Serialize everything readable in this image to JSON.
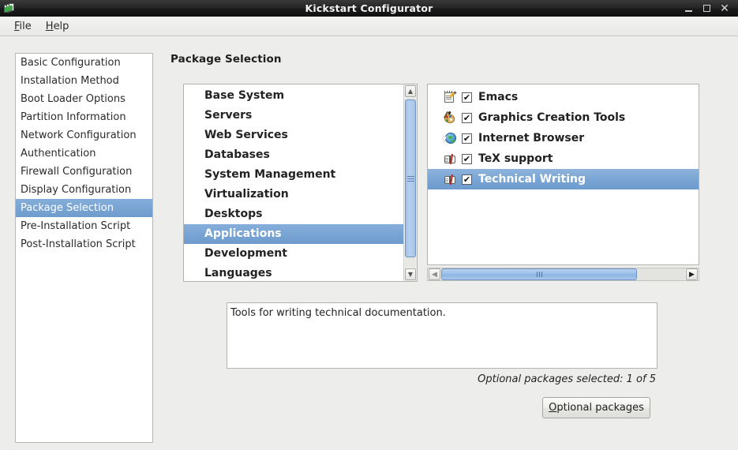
{
  "window": {
    "title": "Kickstart Configurator",
    "icon": "app-icon",
    "controls": {
      "minimize": "minimize-icon",
      "maximize": "maximize-icon",
      "close": "close-icon"
    }
  },
  "menubar": {
    "items": [
      {
        "label": "File",
        "mnemonic": "F"
      },
      {
        "label": "Help",
        "mnemonic": "H"
      }
    ]
  },
  "sidebar": {
    "items": [
      {
        "label": "Basic Configuration",
        "selected": false
      },
      {
        "label": "Installation Method",
        "selected": false
      },
      {
        "label": "Boot Loader Options",
        "selected": false
      },
      {
        "label": "Partition Information",
        "selected": false
      },
      {
        "label": "Network Configuration",
        "selected": false
      },
      {
        "label": "Authentication",
        "selected": false
      },
      {
        "label": "Firewall Configuration",
        "selected": false
      },
      {
        "label": "Display Configuration",
        "selected": false
      },
      {
        "label": "Package Selection",
        "selected": true
      },
      {
        "label": "Pre-Installation Script",
        "selected": false
      },
      {
        "label": "Post-Installation Script",
        "selected": false
      }
    ]
  },
  "main": {
    "heading": "Package Selection",
    "categories": {
      "items": [
        {
          "label": "Base System",
          "selected": false
        },
        {
          "label": "Servers",
          "selected": false
        },
        {
          "label": "Web Services",
          "selected": false
        },
        {
          "label": "Databases",
          "selected": false
        },
        {
          "label": "System Management",
          "selected": false
        },
        {
          "label": "Virtualization",
          "selected": false
        },
        {
          "label": "Desktops",
          "selected": false
        },
        {
          "label": "Applications",
          "selected": true
        },
        {
          "label": "Development",
          "selected": false
        },
        {
          "label": "Languages",
          "selected": false
        }
      ],
      "scrollbar": {
        "up": "scroll-up-icon",
        "down": "scroll-down-icon"
      }
    },
    "packages": {
      "items": [
        {
          "label": "Emacs",
          "icon": "notepad-pencil-icon",
          "checked": true,
          "selected": false
        },
        {
          "label": "Graphics Creation Tools",
          "icon": "paint-palette-icon",
          "checked": true,
          "selected": false
        },
        {
          "label": "Internet Browser",
          "icon": "globe-icon",
          "checked": true,
          "selected": false
        },
        {
          "label": "TeX support",
          "icon": "open-book-icon",
          "checked": true,
          "selected": false
        },
        {
          "label": "Technical Writing",
          "icon": "open-book-icon",
          "checked": true,
          "selected": true
        }
      ],
      "checkmark": "✔",
      "scrollbar": {
        "left": "scroll-left-icon",
        "right": "scroll-right-icon"
      }
    },
    "description": "Tools for writing technical documentation.",
    "status": "Optional packages selected: 1 of 5",
    "optional_button": {
      "label": "Optional packages",
      "mnemonic": "O"
    }
  },
  "colors": {
    "selection_blue": "#6e9ccd",
    "window_bg": "#ededeb",
    "titlebar": "#1a1a1a",
    "list_bg": "#ffffff"
  }
}
